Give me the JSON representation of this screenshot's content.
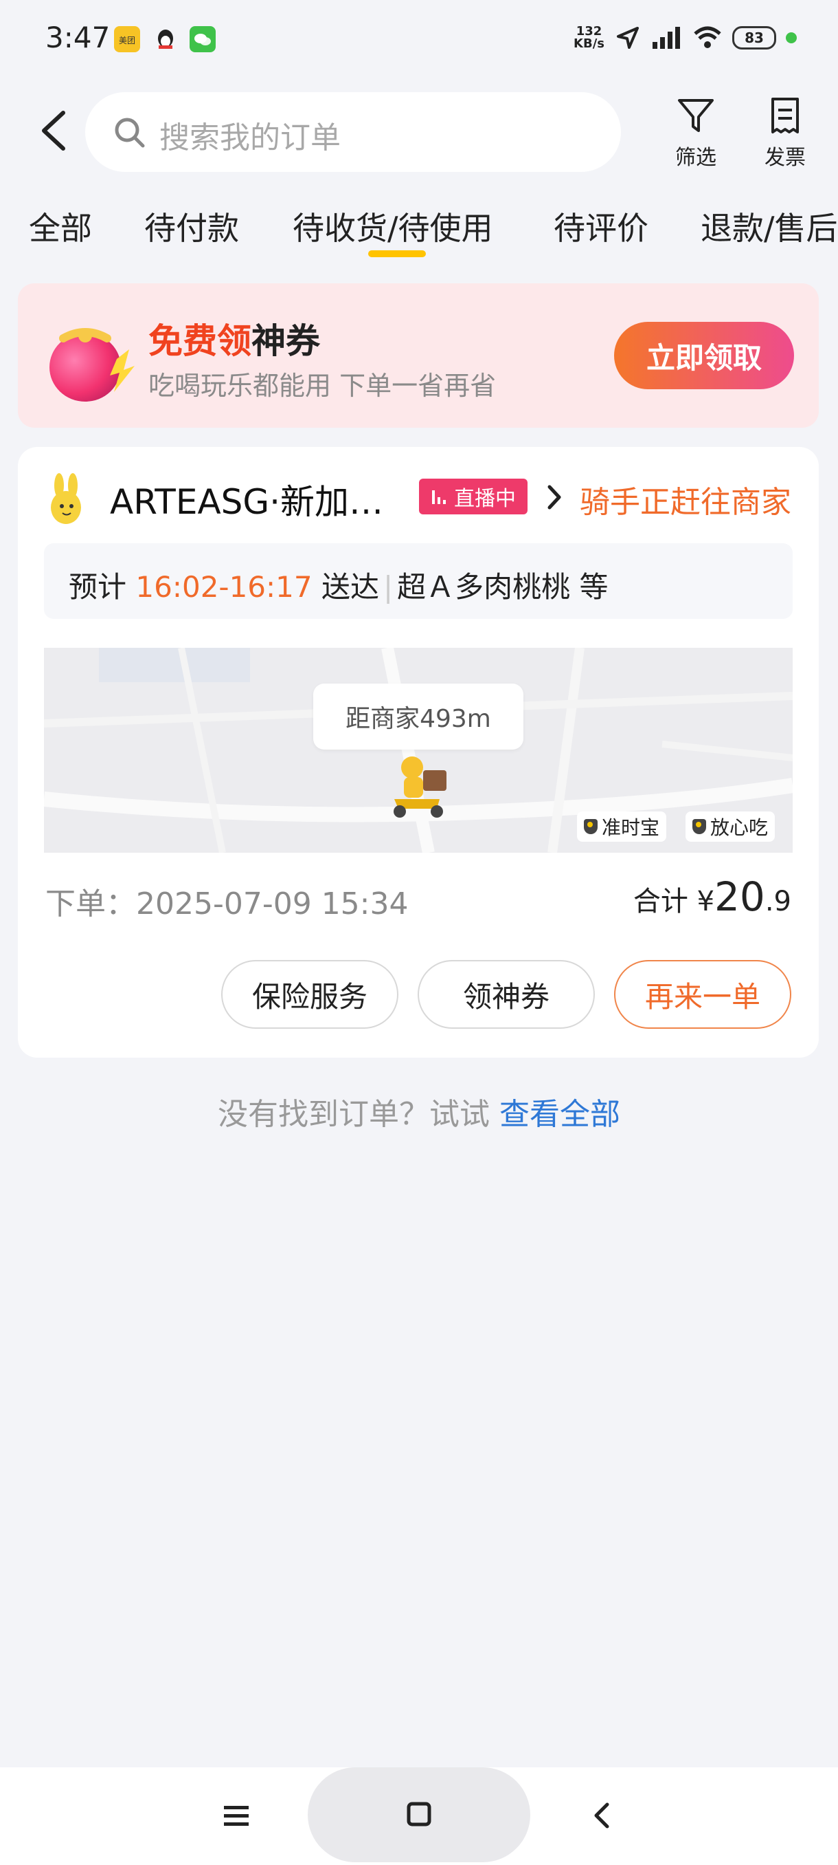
{
  "status_bar": {
    "time": "3:47",
    "apps": [
      "meituan-app-icon",
      "qq-app-icon",
      "wechat-app-icon"
    ],
    "net_speed_value": "132",
    "net_speed_unit": "KB/s",
    "battery": "83"
  },
  "header": {
    "search_placeholder": "搜索我的订单",
    "filter_label": "筛选",
    "invoice_label": "发票"
  },
  "tabs": [
    {
      "label": "全部"
    },
    {
      "label": "待付款"
    },
    {
      "label": "待收货/待使用",
      "active": true
    },
    {
      "label": "待评价"
    },
    {
      "label": "退款/售后"
    }
  ],
  "promo": {
    "title_red": "免费领",
    "title_black": "神券",
    "subtitle": "吃喝玩乐都能用 下单一省再省",
    "button": "立即领取"
  },
  "order": {
    "shop_name": "ARTEASG·新加…",
    "live_badge": "直播中",
    "rider_status": "骑手正赶往商家",
    "eta_prefix": "预计",
    "eta_time": "16:02-16:17",
    "eta_suffix": "送达",
    "items": "超Ａ多肉桃桃 等",
    "map_distance": "距商家493m",
    "map_tags": [
      "准时宝",
      "放心吃"
    ],
    "order_time": "下单：2025-07-09 15:34",
    "total_label": "合计",
    "currency": "¥",
    "total_int": "20",
    "total_dec": ".9",
    "actions": [
      "保险服务",
      "领神券",
      "再来一单"
    ]
  },
  "not_found": {
    "text": "没有找到订单？试试",
    "link": "查看全部"
  },
  "colors": {
    "accent_orange": "#f06a2a",
    "tab_underline": "#ffc300",
    "link_blue": "#2e78d6",
    "live_pink": "#ee3a6a"
  }
}
